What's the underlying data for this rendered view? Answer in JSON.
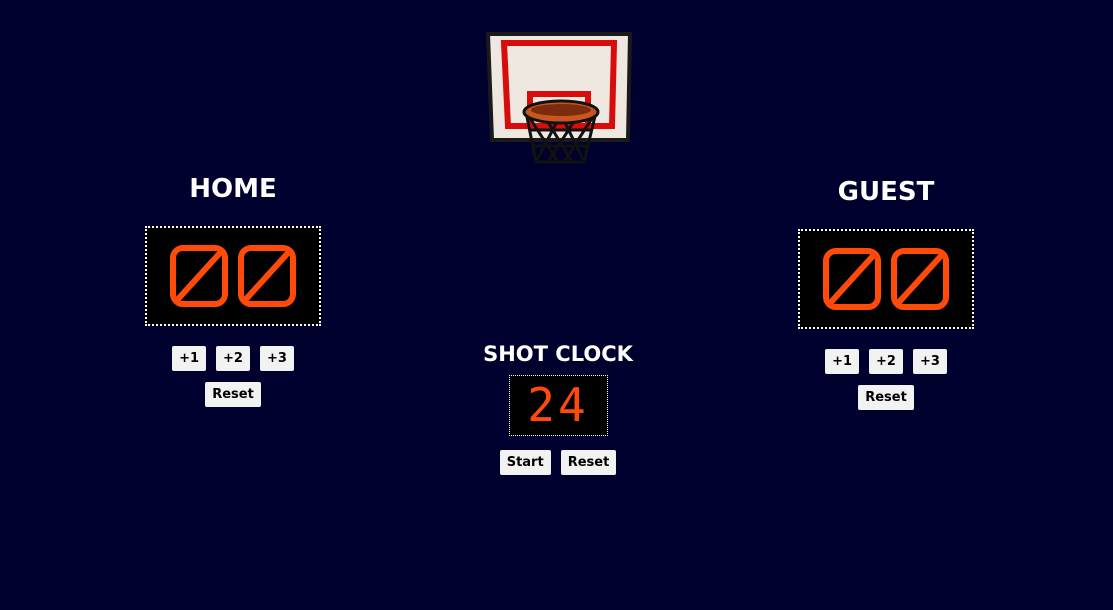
{
  "colors": {
    "background": "#00002e",
    "digit": "#ff4a0a",
    "button_bg": "#f2f2f2"
  },
  "hoop": {
    "icon": "basketball-hoop-icon"
  },
  "home": {
    "title": "HOME",
    "score": "00",
    "buttons": {
      "plus1": "+1",
      "plus2": "+2",
      "plus3": "+3",
      "reset": "Reset"
    }
  },
  "guest": {
    "title": "GUEST",
    "score": "00",
    "buttons": {
      "plus1": "+1",
      "plus2": "+2",
      "plus3": "+3",
      "reset": "Reset"
    }
  },
  "shot_clock": {
    "title": "SHOT CLOCK",
    "value": "24",
    "buttons": {
      "start": "Start",
      "reset": "Reset"
    }
  }
}
